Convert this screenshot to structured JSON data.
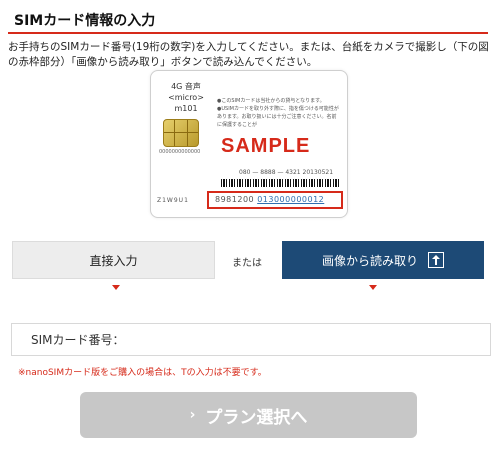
{
  "section_title": "SIMカード情報の入力",
  "intro_text": "お手持ちのSIMカード番号(19桁の数字)を入力してください。または、台紙をカメラで撮影し（下の図の赤枠部分）「画像から読み取り」ボタンで読み込んでください。",
  "sim_card": {
    "type_line1": "4G 音声",
    "type_line2": "<micro>",
    "type_line3": "m101",
    "notes": "●このSIMカードは当社からの貸与となります。●USIMカードを取り外す際に、指を傷つける可能性があります。お取り扱いには十分ご注意ください。名前に保護することが",
    "sample_label": "SAMPLE",
    "phone_line": "080 — 8888 — 4321    20130521",
    "card_mark": "Z1W9U1",
    "serial_prefix": "8981200",
    "serial_selected": "013000000012",
    "chip_code": "0000000000000"
  },
  "buttons": {
    "direct_input": "直接入力",
    "or_label": "または",
    "read_from_image": "画像から読み取り"
  },
  "sim_number_input": {
    "placeholder": "SIMカード番号：",
    "value": ""
  },
  "nano_note": "※nanoSIMカード版をご購入の場合は、Tの入力は不要です。",
  "next_button": {
    "chevron": "›",
    "label": "プラン選択へ"
  },
  "colors": {
    "accent_red": "#d62a1a",
    "navy": "#1d4a76",
    "disabled_gray": "#c7c7c7"
  }
}
